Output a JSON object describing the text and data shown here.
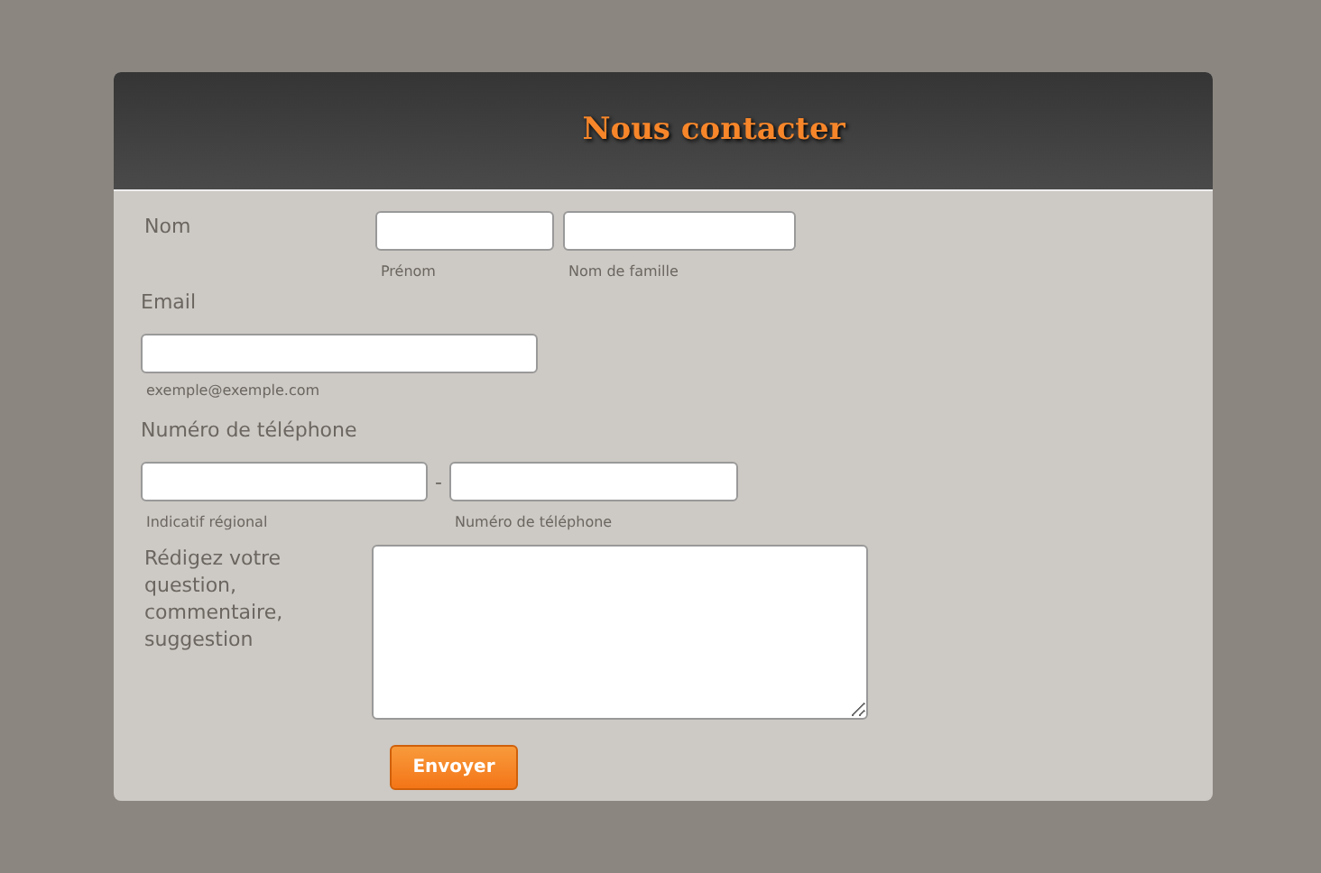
{
  "title": "Nous contacter",
  "name": {
    "label": "Nom",
    "fields": [
      {
        "sublabel": "Prénom"
      },
      {
        "sublabel": "Nom de famille"
      }
    ]
  },
  "email": {
    "label": "Email",
    "sublabel": "exemple@exemple.com"
  },
  "phone": {
    "label": "Numéro de téléphone",
    "separator": "-",
    "fields": [
      {
        "sublabel": "Indicatif régional"
      },
      {
        "sublabel": "Numéro de téléphone"
      }
    ]
  },
  "message": {
    "label": "Rédigez votre question, commentaire, suggestion"
  },
  "submit": "Envoyer"
}
